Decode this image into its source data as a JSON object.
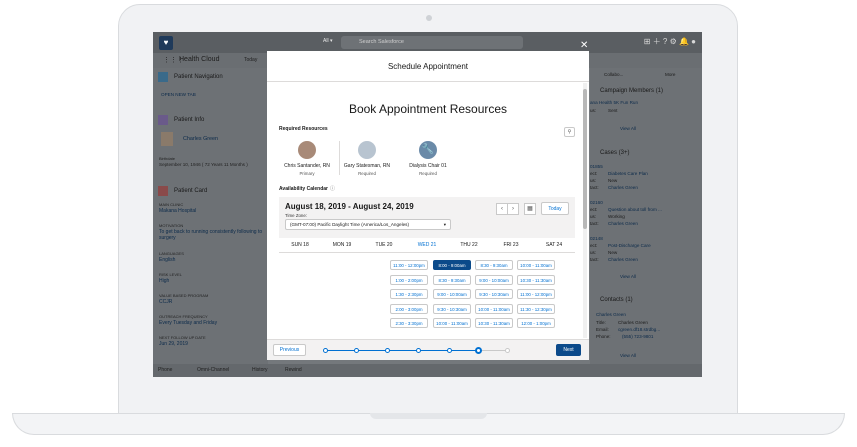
{
  "topbar": {
    "all_label": "All ▾",
    "search_placeholder": "Search Salesforce"
  },
  "nav": {
    "app_title": "Health Cloud",
    "tab": "Today"
  },
  "left": {
    "patient_nav": "Patient Navigation",
    "open_new_tab": "OPEN NEW TAB",
    "patient_info": "Patient Info",
    "patient_name": "Charles Green",
    "birthdate_label": "Birthdate",
    "birthdate": "September 10, 1946 ( 72 Years 11 Months )",
    "patient_card": "Patient Card",
    "fields": [
      {
        "label": "MAIN CLINIC",
        "value": "Makana Hospital"
      },
      {
        "label": "MOTIVATION",
        "value": "To get back to running consistently following to surgery"
      },
      {
        "label": "LANGUAGES",
        "value": "English"
      },
      {
        "label": "RISK LEVEL",
        "value": "High"
      },
      {
        "label": "VALUE BASED PROGRAM",
        "value": "CCJR"
      },
      {
        "label": "OUTREACH FREQUENCY",
        "value": "Every Tuesday and Friday"
      },
      {
        "label": "NEXT FOLLOW UP DATE",
        "value": "Jun 29, 2019"
      }
    ]
  },
  "right": {
    "collab": "Collabo...",
    "more": "More",
    "campaign_title": "Campaign Members (1)",
    "campaign_item": "ana Health 5K Fun Run",
    "campaign_status_label": "us:",
    "campaign_status": "Sent",
    "view_all": "View All",
    "cases_title": "Cases (3+)",
    "cases": [
      {
        "num": "01855",
        "subject": "Diabetes Care Plan",
        "status": "New",
        "contact": "Charles Green"
      },
      {
        "num": "02160",
        "subject": "Question about toll from ...",
        "status": "Working",
        "contact": "Charles Green"
      },
      {
        "num": "02148",
        "subject": "Post-Discharge Care",
        "status": "New",
        "contact": "Charles Green"
      }
    ],
    "case_labels": {
      "subject": "ect:",
      "status": "us:",
      "contact": "tact:"
    },
    "contacts_title": "Contacts (1)",
    "contact_name": "Charles Green",
    "contact_title_label": "Title:",
    "contact_title": "Charles Green",
    "contact_email_label": "Email:",
    "contact_email": "cgreen.df18.strdbg...",
    "contact_phone_label": "Phone:",
    "contact_phone": "(555) 723-9801"
  },
  "footer": {
    "phone": "Phone",
    "omni": "Omni-Channel",
    "history": "History",
    "rewind": "Rewind"
  },
  "modal": {
    "header": "Schedule Appointment",
    "title": "Book Appointment Resources",
    "required_resources": "Required Resources",
    "resources": [
      {
        "name": "Chris Santander, RN",
        "role": "Primary"
      },
      {
        "name": "Gary Statesman, RN",
        "role": "Required"
      },
      {
        "name": "Dialysis Chair 01",
        "role": "Required"
      }
    ],
    "availability": "Availability Calendar",
    "range": "August 18, 2019 - August 24, 2019",
    "tz_label": "Time Zone:",
    "tz_value": "(GMT-07:00) Pacific Daylight Time (America/Los_Angeles)",
    "today": "Today",
    "days": [
      "SUN 18",
      "MON 19",
      "TUE 20",
      "WED 21",
      "THU 22",
      "FRI 23",
      "SAT 24"
    ],
    "slots": {
      "wed": [
        "11:00 - 12:00pm",
        "1:00 - 2:00pm",
        "1:30 - 2:30pm",
        "2:00 - 3:00pm",
        "2:30 - 3:30pm"
      ],
      "thu": [
        "8:00 - 9:00am",
        "8:30 - 9:30am",
        "9:00 - 10:00am",
        "9:30 - 10:30am",
        "10:00 - 11:00am"
      ],
      "fri": [
        "8:30 - 9:30am",
        "9:00 - 10:00am",
        "9:30 - 10:30am",
        "10:00 - 11:00am",
        "10:30 - 11:30am"
      ],
      "sat": [
        "10:00 - 11:00am",
        "10:30 - 11:30am",
        "11:00 - 12:00pm",
        "11:30 - 12:30pm",
        "12:00 - 1:00pm"
      ]
    },
    "previous": "Previous",
    "next": "Next"
  }
}
